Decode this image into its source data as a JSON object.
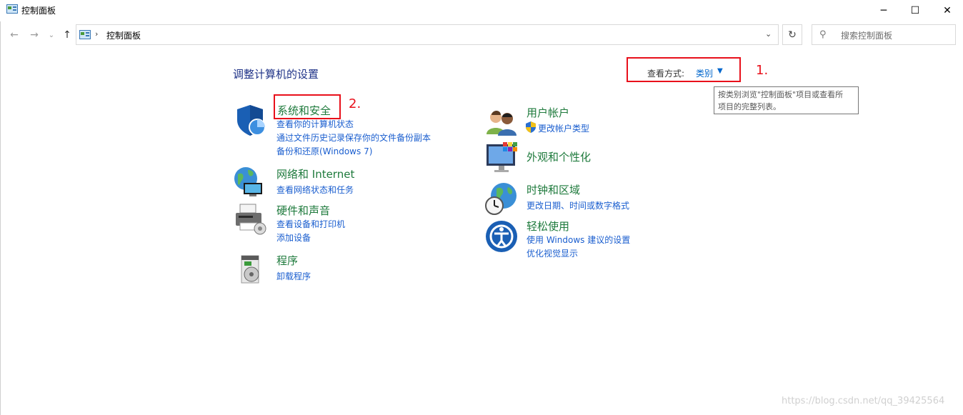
{
  "window": {
    "title": "控制面板",
    "minimize": "─",
    "maximize": "☐",
    "close": "✕"
  },
  "nav": {
    "back": "←",
    "forward": "→",
    "recent": "⌄",
    "up": "↑",
    "address_sep": "›",
    "address": "控制面板",
    "address_dropdown": "⌄",
    "refresh": "↻",
    "search_placeholder": "搜索控制面板"
  },
  "content": {
    "heading": "调整计算机的设置",
    "view_by_label": "查看方式:",
    "view_by_value": "类别",
    "view_by_caret": "▼",
    "tooltip": "按类别浏览\"控制面板\"项目或查看所有项目的完整列表。",
    "tooltip_lines": [
      "按类别浏览\"控制面板\"项目或查看所",
      "项目的完整列表。"
    ],
    "annotation_1": "1.",
    "annotation_2": "2.",
    "left_categories": [
      {
        "title": "系统和安全",
        "links": [
          "查看你的计算机状态",
          "通过文件历史记录保存你的文件备份副本",
          "备份和还原(Windows 7)"
        ]
      },
      {
        "title": "网络和 Internet",
        "links": [
          "查看网络状态和任务"
        ]
      },
      {
        "title": "硬件和声音",
        "links": [
          "查看设备和打印机",
          "添加设备"
        ]
      },
      {
        "title": "程序",
        "links": [
          "卸载程序"
        ]
      }
    ],
    "right_categories": [
      {
        "title": "用户帐户",
        "links": [
          "更改帐户类型"
        ]
      },
      {
        "title": "外观和个性化",
        "links": []
      },
      {
        "title": "时钟和区域",
        "links": [
          "更改日期、时间或数字格式"
        ]
      },
      {
        "title": "轻松使用",
        "links": [
          "使用 Windows 建议的设置",
          "优化视觉显示"
        ]
      }
    ]
  },
  "watermark": "https://blog.csdn.net/qq_39425564",
  "colors": {
    "heading": "#1e3287",
    "category_title": "#1e7a3c",
    "link": "#1a5ecf",
    "annotation": "#e8101b"
  }
}
